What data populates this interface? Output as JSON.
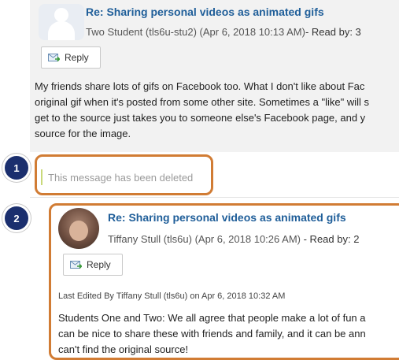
{
  "post1": {
    "title": "Re: Sharing personal videos as animated gifs",
    "author": "Two Student (tls6u-stu2)",
    "date": "(Apr 6, 2018 10:13 AM)",
    "read_by": "- Read by: 3",
    "reply_label": "Reply",
    "body_lines": [
      "My friends share lots of gifs on Facebook too.  What I don't like about Fac",
      "original gif when it's posted from some other site.  Sometimes a \"like\" will s",
      "get to the source just takes you to someone else's Facebook page, and y",
      "source for the image."
    ]
  },
  "deleted": {
    "text": "This message has been deleted"
  },
  "post2": {
    "title": "Re: Sharing personal videos as animated gifs",
    "author": "Tiffany Stull (tls6u)",
    "date": "(Apr 6, 2018 10:26 AM)",
    "read_by": "- Read by: 2",
    "reply_label": "Reply",
    "edited": "Last Edited By Tiffany Stull (tls6u) on Apr 6, 2018 10:32 AM",
    "body_lines": [
      "Students One and Two: We all agree that people make a lot of fun a",
      "can be nice to share these with friends and family, and it can be ann",
      "can't find the original source!"
    ]
  },
  "badges": {
    "one": "1",
    "two": "2"
  },
  "colors": {
    "highlight": "#d17c34",
    "badge": "#1b2f6e",
    "title_link": "#1f5e99"
  }
}
